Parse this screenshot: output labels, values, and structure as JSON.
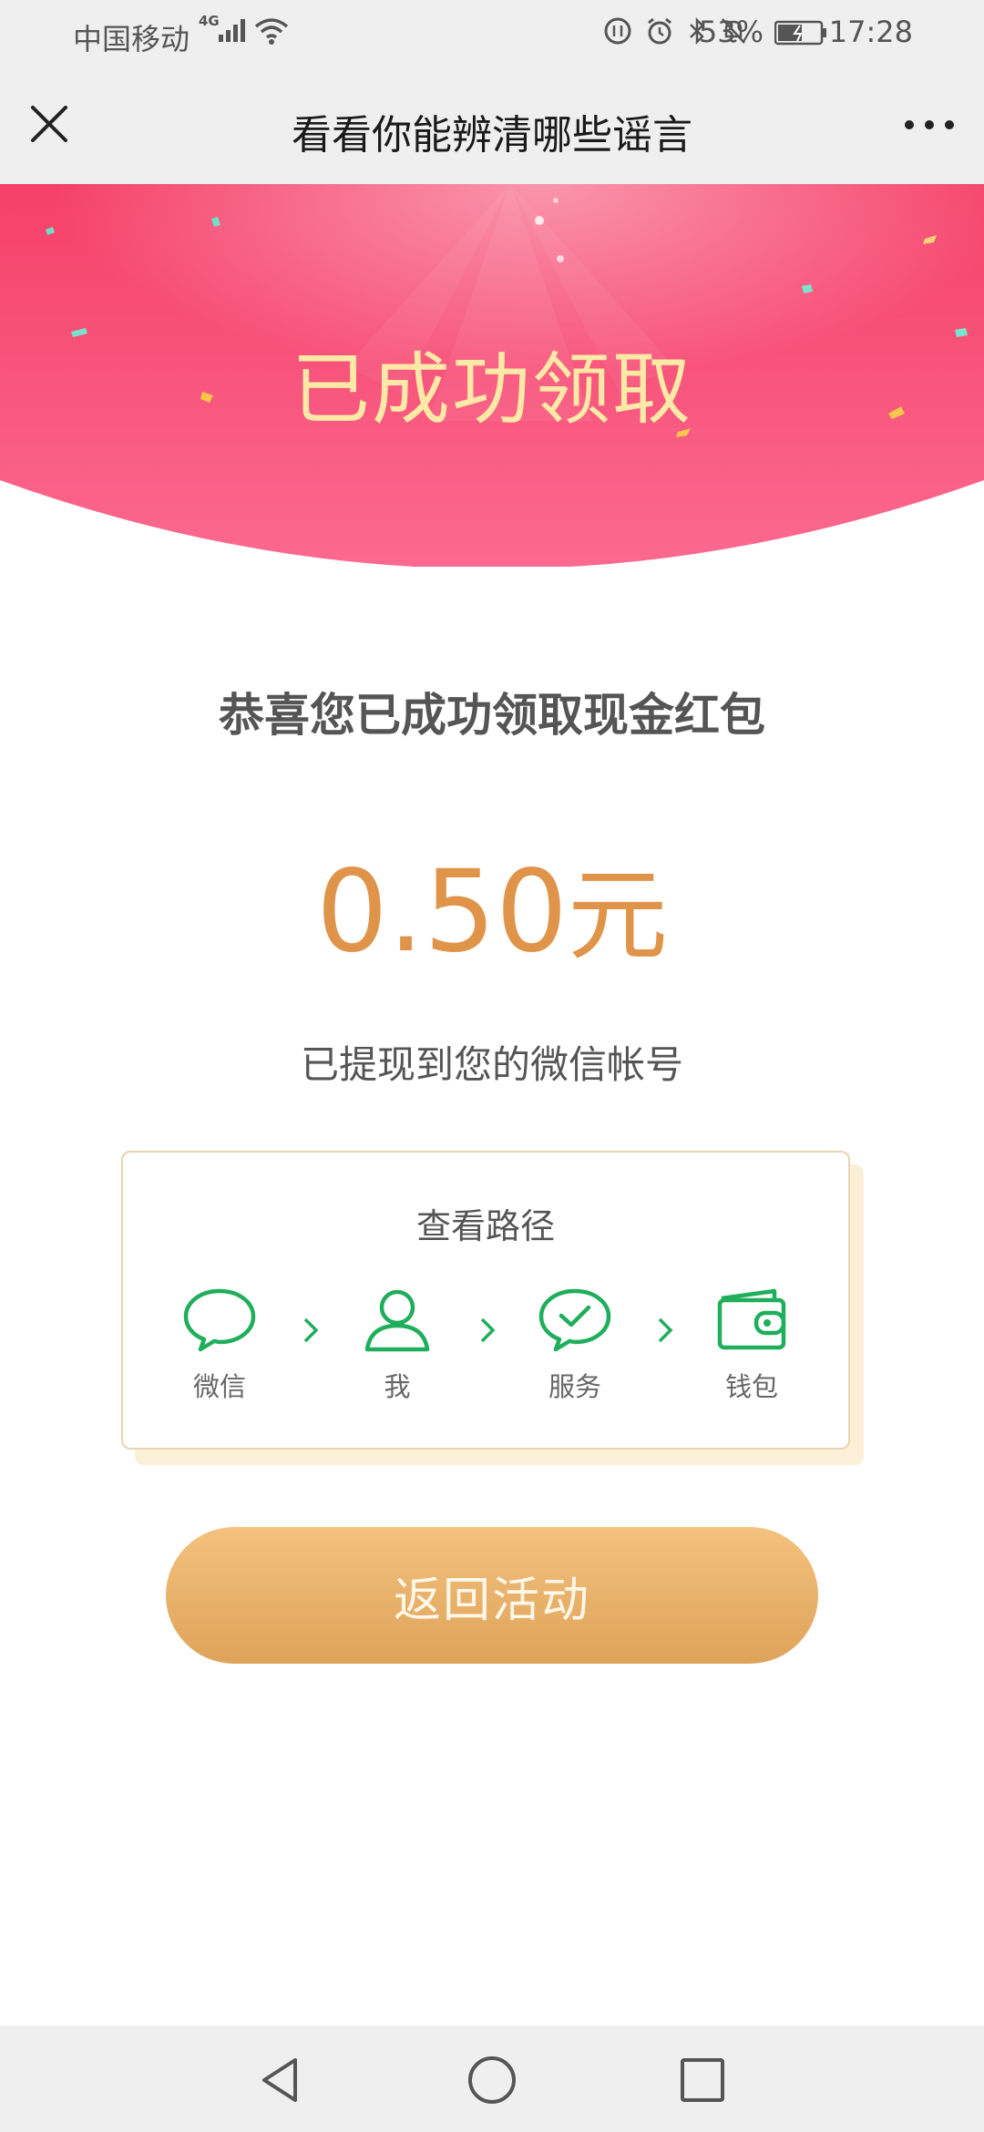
{
  "status_bar": {
    "carrier": "中国移动",
    "network": "4G",
    "battery_percent": "53%",
    "time": "17:28"
  },
  "title_bar": {
    "title": "看看你能辨清哪些谣言",
    "close_icon": "close-icon",
    "more_icon": "more-icon"
  },
  "banner": {
    "headline": "已成功领取"
  },
  "main": {
    "congrats_text": "恭喜您已成功领取现金红包",
    "amount_value": "0.50",
    "amount_unit": "元",
    "withdrawn_text": "已提现到您的微信帐号"
  },
  "path_card": {
    "title": "查看路径",
    "steps": [
      {
        "label": "微信",
        "icon": "chat-bubble-icon"
      },
      {
        "label": "我",
        "icon": "user-icon"
      },
      {
        "label": "服务",
        "icon": "check-bubble-icon"
      },
      {
        "label": "钱包",
        "icon": "wallet-icon"
      }
    ]
  },
  "return_button": {
    "label": "返回活动"
  },
  "colors": {
    "banner_pink": "#f4466f",
    "headline_gold": "#fde9a6",
    "amount_orange": "#e0944a",
    "wechat_green": "#1aad19",
    "button_gold": "#e6ad64"
  }
}
